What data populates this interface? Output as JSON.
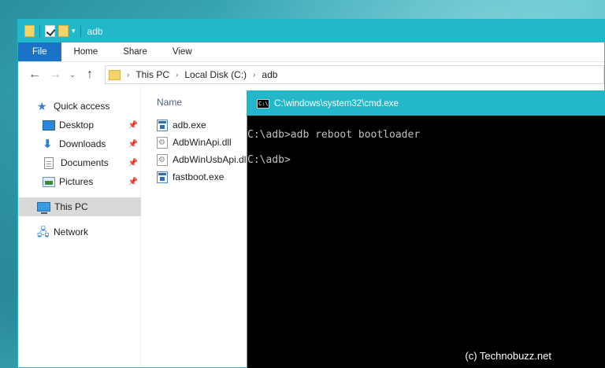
{
  "explorer": {
    "title": "adb",
    "ribbon_tabs": [
      "File",
      "Home",
      "Share",
      "View"
    ],
    "breadcrumb": [
      "This PC",
      "Local Disk (C:)",
      "adb"
    ],
    "nav_items": [
      {
        "label": "Quick access",
        "icon": "star-icon"
      },
      {
        "label": "Desktop",
        "icon": "desktop-icon"
      },
      {
        "label": "Downloads",
        "icon": "downloads-icon"
      },
      {
        "label": "Documents",
        "icon": "documents-icon"
      },
      {
        "label": "Pictures",
        "icon": "pictures-icon"
      },
      {
        "label": "This PC",
        "icon": "computer-icon"
      },
      {
        "label": "Network",
        "icon": "network-icon"
      }
    ],
    "column_name": "Name",
    "files": [
      {
        "name": "adb.exe",
        "type": "exe"
      },
      {
        "name": "AdbWinApi.dll",
        "type": "dll"
      },
      {
        "name": "AdbWinUsbApi.dll",
        "type": "dll"
      },
      {
        "name": "fastboot.exe",
        "type": "exe"
      }
    ]
  },
  "cmd": {
    "title": "C:\\windows\\system32\\cmd.exe",
    "icon_text": "C:\\",
    "lines": [
      "C:\\adb>adb reboot bootloader",
      "C:\\adb>"
    ]
  },
  "watermark": "(c) Technobuzz.net",
  "colors": {
    "titlebar": "#22b8c9",
    "file_tab": "#1a73c6",
    "selection": "#d9d9d9",
    "console_bg": "#000000",
    "console_text": "#c0c0c0"
  }
}
